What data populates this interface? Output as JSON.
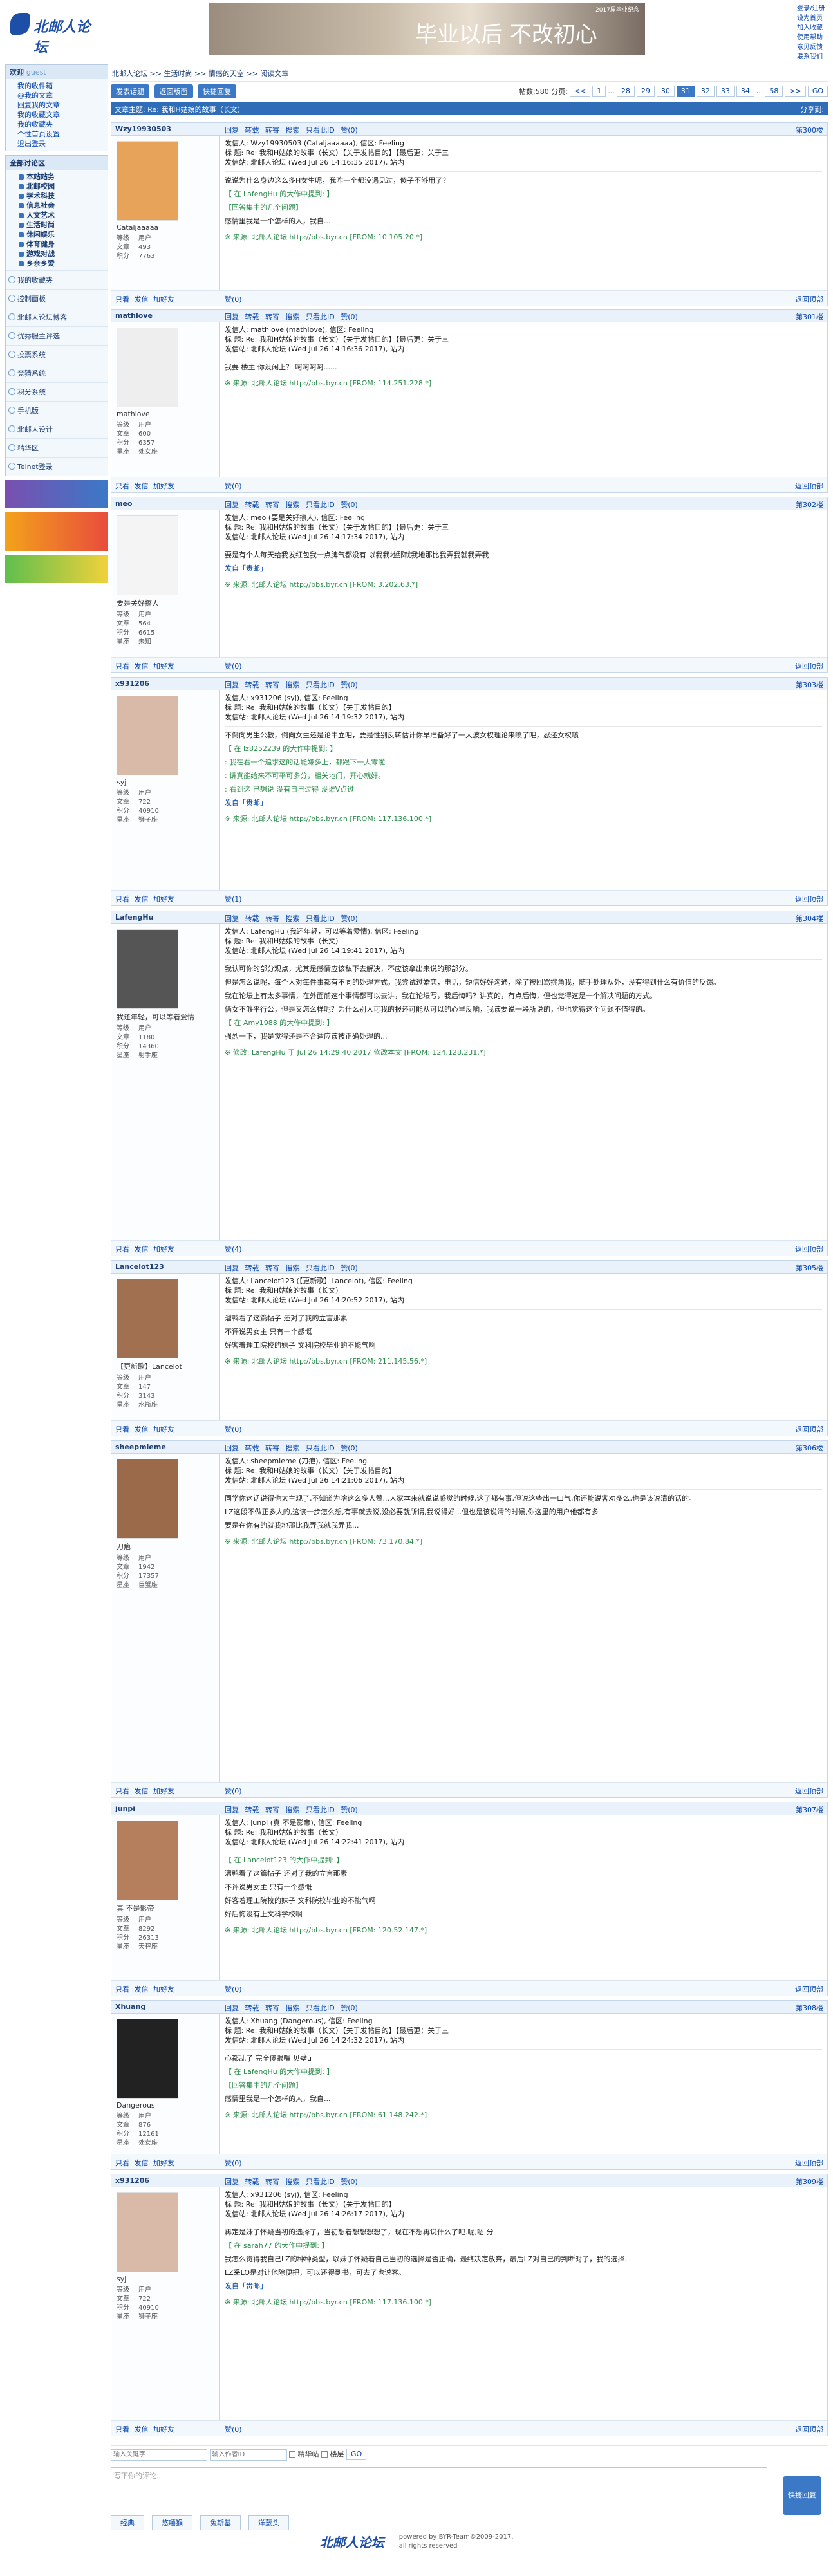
{
  "site": {
    "logo": "北邮人论坛",
    "banner": "毕业以后  不改初心",
    "banner_sub": "2017届毕业纪念"
  },
  "toplinks": [
    "登录/注册",
    "设为首页",
    "加入收藏",
    "使用帮助",
    "意见反馈",
    "联系我们"
  ],
  "welcome": {
    "title": "欢迎",
    "user": "guest",
    "links": [
      "我的收件箱",
      "@我的文章",
      "回复我的文章",
      "我的收藏文章",
      "我的收藏夹",
      "个性首页设置",
      "退出登录"
    ]
  },
  "categories_title": "全部讨论区",
  "categories": [
    "本站站务",
    "北邮校园",
    "学术科技",
    "信息社会",
    "人文艺术",
    "生活时尚",
    "休闲娱乐",
    "体育健身",
    "游戏对战",
    "乡亲乡爱"
  ],
  "side_sections": [
    "我的收藏夹",
    "控制面板",
    "北邮人论坛博客",
    "优秀服主评选",
    "投票系统",
    "竞猜系统",
    "积分系统",
    "手机版",
    "北邮人设计",
    "精华区",
    "Telnet登录"
  ],
  "breadcrumb": "北邮人论坛  >>  生活时尚  >>  情感的天空  >>  阅读文章",
  "actions": [
    "发表话题",
    "返回版面",
    "快捷回复"
  ],
  "pager": {
    "info": "帖数:580  分页:",
    "pages": [
      "<<",
      "1",
      "...",
      "28",
      "29",
      "30",
      "31",
      "32",
      "33",
      "34",
      "...",
      "58",
      ">>"
    ],
    "current": "31",
    "go": "GO"
  },
  "title_bar": {
    "label": "文章主题: Re: 我和H姑娘的故事（长文）",
    "right": "分享到:"
  },
  "tools": "回复  转载  转寄  搜索  只看此ID  赞(0)",
  "footer_tools": "只看  发信  加好友",
  "posts": [
    {
      "name": "Wzy19930503",
      "floor": "第300楼",
      "top": "返回顶部",
      "nick": "Cataljaaaaa",
      "stats": [
        [
          "等级",
          "用户"
        ],
        [
          "文章",
          "493"
        ],
        [
          "积分",
          "7763"
        ]
      ],
      "likes": "赞(0)",
      "header": "发信人: Wzy19930503 (Cataljaaaaaa), 信区: Feeling",
      "title": "标  题: Re: 我和H姑娘的故事（长文）【关于发帖目的】【最后更：关于三",
      "station": "发信站: 北邮人论坛 (Wed Jul 26 14:16:35 2017), 站内",
      "body": [
        "说说为什么身边这么多H女生呢，我咋一个都没遇见过，傻子不够用了？",
        "【 在 LafengHu 的大作中提到: 】",
        "【回答集中的几个问题】",
        "感情里我是一个怎样的人，我自..."
      ],
      "src": "※ 来源: 北邮人论坛 http://bbs.byr.cn [FROM: 10.105.20.*]"
    },
    {
      "name": "mathlove",
      "floor": "第301楼",
      "top": "返回顶部",
      "nick": "mathlove",
      "stats": [
        [
          "等级",
          "用户"
        ],
        [
          "文章",
          "600"
        ],
        [
          "积分",
          "6357"
        ],
        [
          "星座",
          "处女座"
        ]
      ],
      "likes": "赞(0)",
      "header": "发信人: mathlove (mathlove), 信区: Feeling",
      "title": "标  题: Re: 我和H姑娘的故事（长文）【关于发帖目的】【最后更：关于三",
      "station": "发信站: 北邮人论坛 (Wed Jul 26 14:16:36 2017), 站内",
      "body": [
        "我要 楼主 你没闲上？  呵呵呵呵......"
      ],
      "src": "※ 来源: 北邮人论坛 http://bbs.byr.cn [FROM: 114.251.228.*]"
    },
    {
      "name": "meo",
      "floor": "第302楼",
      "top": "返回顶部",
      "nick": "要是关好擦人",
      "stats": [
        [
          "等级",
          "用户"
        ],
        [
          "文章",
          "564"
        ],
        [
          "积分",
          "6615"
        ],
        [
          "星座",
          "未知"
        ]
      ],
      "likes": "赞(0)",
      "header": "发信人: meo (要是关好擦人), 信区: Feeling",
      "title": "标  题: Re: 我和H姑娘的故事（长文）【关于发帖目的】【最后更：关于三",
      "station": "发信站: 北邮人论坛 (Wed Jul 26 14:17:34 2017), 站内",
      "body": [
        "要是有个人每天给我发红包我一点脾气都没有  以我我地那就我地那比我弄我就我弄我",
        "发自「贵邮」"
      ],
      "src": "※ 来源: 北邮人论坛 http://bbs.byr.cn [FROM: 3.202.63.*]"
    },
    {
      "name": "x931206",
      "floor": "第303楼",
      "top": "返回顶部",
      "nick": "syj",
      "stats": [
        [
          "等级",
          "用户"
        ],
        [
          "文章",
          "722"
        ],
        [
          "积分",
          "40910"
        ],
        [
          "星座",
          "狮子座"
        ]
      ],
      "likes": "赞(1)",
      "header": "发信人: x931206 (syj), 信区: Feeling",
      "title": "标  题: Re: 我和H姑娘的故事（长文）【关于发帖目的】",
      "station": "发信站: 北邮人论坛 (Wed Jul 26 14:19:32 2017), 站内",
      "body": [
        "不倒向男生公教，倒向女生还是论中立吧，要是性别反转估计你早准备好了一大波女权理论来喷了吧，忍还女权喷",
        "【 在 lz8252239 的大作中提到: 】",
        ": 我在看一个追求这的话能嫌多上，都跟下一大零啦",
        ": 讲真能给来不可平可多分，相关地门，开心就好。",
        ": 看到这 已想说 没有自己过得 没谁V点过",
        "发自「贵邮」"
      ],
      "src": "※ 来源: 北邮人论坛 http://bbs.byr.cn [FROM: 117.136.100.*]"
    },
    {
      "name": "LafengHu",
      "floor": "第304楼",
      "top": "返回顶部",
      "nick": "我还年轻，可以等着爱情",
      "stats": [
        [
          "等级",
          "用户"
        ],
        [
          "文章",
          "1180"
        ],
        [
          "积分",
          "14360"
        ],
        [
          "星座",
          "射手座"
        ]
      ],
      "likes": "赞(4)",
      "header": "发信人: LafengHu (我还年轻，可以等着爱情), 信区: Feeling",
      "title": "标  题: Re: 我和H姑娘的故事（长文）",
      "station": "发信站: 北邮人论坛 (Wed Jul 26 14:19:41 2017), 站内",
      "body": [
        "我认可你的部分观点，尤其是感情应该私下去解决，不应该拿出来说的那部分。",
        "但是怎么说呢，每个人对每件事都有不同的处理方式，我尝试过婚恋，电话，短信好好沟通，除了被回骂挑角我，随手处理从外，没有得到什么有价值的反馈。",
        "我在论坛上有太多事情，在外面前这个事情都可以去讲，我在论坛写，我后悔吗？讲真的，有点后悔，但也觉得这是一个解决问题的方式。",
        "俩女不够平行公，但是又怎么样呢？为什么别人可我的报还可能从可以的心里反响，我该要说一段所说的，但也觉得这个问题不值得的。",
        "【 在 Amy1988 的大作中提到: 】",
        "强烈一下，我是觉得还是不合适应该被正确处理的..."
      ],
      "src": "※ 修改: LafengHu 于 Jul 26 14:29:40 2017 修改本文 [FROM: 124.128.231.*]"
    },
    {
      "name": "Lancelot123",
      "floor": "第305楼",
      "top": "返回顶部",
      "nick": "【更新歌】Lancelot",
      "stats": [
        [
          "等级",
          "用户"
        ],
        [
          "文章",
          "147"
        ],
        [
          "积分",
          "3143"
        ],
        [
          "星座",
          "水瓶座"
        ]
      ],
      "likes": "赞(0)",
      "header": "发信人: Lancelot123 (【更新歌】Lancelot), 信区: Feeling",
      "title": "标  题: Re: 我和H姑娘的故事（长文）",
      "station": "发信站: 北邮人论坛 (Wed Jul 26 14:20:52 2017), 站内",
      "body": [
        "溜鸭看了这篇帖子 还对了我的立言那素",
        "不评说男女主 只有一个感慨",
        "好客着理工院校的妹子 文科院校毕业的不能气啊"
      ],
      "src": "※ 来源: 北邮人论坛 http://bbs.byr.cn [FROM: 211.145.56.*]"
    },
    {
      "name": "sheepmieme",
      "floor": "第306楼",
      "top": "返回顶部",
      "nick": "刀疤",
      "stats": [
        [
          "等级",
          "用户"
        ],
        [
          "文章",
          "1942"
        ],
        [
          "积分",
          "17357"
        ],
        [
          "星座",
          "巨蟹座"
        ]
      ],
      "likes": "赞(0)",
      "header": "发信人: sheepmieme (刀疤), 信区: Feeling",
      "title": "标  题: Re: 我和H姑娘的故事（长文）【关于发帖目的】",
      "station": "发信站: 北邮人论坛 (Wed Jul 26 14:21:06 2017), 站内",
      "body": [
        "同学你这话说得也太主观了,不知道为啥这么多人赞...人家本来就说说感觉的时候,这了都有事,但说这些出一口气,你还能说客劝多么,也是该说清的话的。",
        "LZ这段不做正多人的,这该一步怎么想,有事就去说,没必要就所谓,我说得好...但也是该说清的时候,你这里的用户他都有多",
        "要是在你有的就我地那比我弄我就我弄我..."
      ],
      "src": "※ 来源: 北邮人论坛 http://bbs.byr.cn [FROM: 73.170.84.*]"
    },
    {
      "name": "junpi",
      "floor": "第307楼",
      "top": "返回顶部",
      "nick": "真 不是影帝",
      "stats": [
        [
          "等级",
          "用户"
        ],
        [
          "文章",
          "8292"
        ],
        [
          "积分",
          "26313"
        ],
        [
          "星座",
          "天秤座"
        ]
      ],
      "likes": "赞(0)",
      "header": "发信人: junpi (真 不是影帝), 信区: Feeling",
      "title": "标  题: Re: 我和H姑娘的故事（长文）",
      "station": "发信站: 北邮人论坛 (Wed Jul 26 14:22:41 2017), 站内",
      "body": [
        "【 在 Lancelot123 的大作中提到: 】",
        "溜鸭看了这篇帖子 还对了我的立言那素",
        "不评说男女主 只有一个感慨",
        "好客着理工院校的妹子 文科院校毕业的不能气啊",
        "好后悔没有上文科学校啊"
      ],
      "src": "※ 来源: 北邮人论坛 http://bbs.byr.cn [FROM: 120.52.147.*]"
    },
    {
      "name": "Xhuang",
      "floor": "第308楼",
      "top": "返回顶部",
      "nick": "Dangerous",
      "stats": [
        [
          "等级",
          "用户"
        ],
        [
          "文章",
          "876"
        ],
        [
          "积分",
          "12161"
        ],
        [
          "星座",
          "处女座"
        ]
      ],
      "likes": "赞(0)",
      "header": "发信人: Xhuang (Dangerous), 信区: Feeling",
      "title": "标  题: Re: 我和H姑娘的故事（长文）【关于发帖目的】【最后更：关于三",
      "station": "发信站: 北邮人论坛 (Wed Jul 26 14:24:32 2017), 站内",
      "body": [
        "心都乱了 完全傻眼嘿 贝壁u",
        "【 在 LafengHu 的大作中提到: 】",
        "【回答集中的几个问题】",
        "感情里我是一个怎样的人，我自..."
      ],
      "src": "※ 来源: 北邮人论坛 http://bbs.byr.cn [FROM: 61.148.242.*]"
    },
    {
      "name": "x931206",
      "floor": "第309楼",
      "top": "返回顶部",
      "nick": "syj",
      "stats": [
        [
          "等级",
          "用户"
        ],
        [
          "文章",
          "722"
        ],
        [
          "积分",
          "40910"
        ],
        [
          "星座",
          "狮子座"
        ]
      ],
      "likes": "赞(0)",
      "header": "发信人: x931206 (syj), 信区: Feeling",
      "title": "标  题: Re: 我和H姑娘的故事（长文）【关于发帖目的】",
      "station": "发信站: 北邮人论坛 (Wed Jul 26 14:26:17 2017), 站内",
      "body": [
        "再定是妹子怀疑当初的选择了，当初想着想想想想了，现在不想再说什么了吧.呢,嗯 分",
        "【 在 sarah77 的大作中提到: 】",
        "我怎么觉得我自己LZ的种种类型，以妹子怀疑着自己当初的选择是否正确，最终决定放弃，最后LZ对自己的判断对了，我的选择.",
        "LZ采LO是对让他除便把，可以还得到书，可去了也说客。",
        "发自「贵邮」"
      ],
      "src": "※ 来源: 北邮人论坛 http://bbs.byr.cn [FROM: 117.136.100.*]"
    }
  ],
  "bottom_bar": {
    "search1": "输入关键字",
    "search2": "输入作者ID",
    "chk1": "精华帖",
    "chk2": "楼层",
    "go": "GO"
  },
  "reply": {
    "placeholder": "写下你的评论...",
    "submit": "快捷回复",
    "faces": [
      "经典",
      "悠嘻猴",
      "兔斯基",
      "洋葱头"
    ]
  },
  "footer": {
    "logo": "北邮人论坛",
    "line1": "powered by BYR-Team©2009-2017.",
    "line2": "all rights reserved"
  }
}
